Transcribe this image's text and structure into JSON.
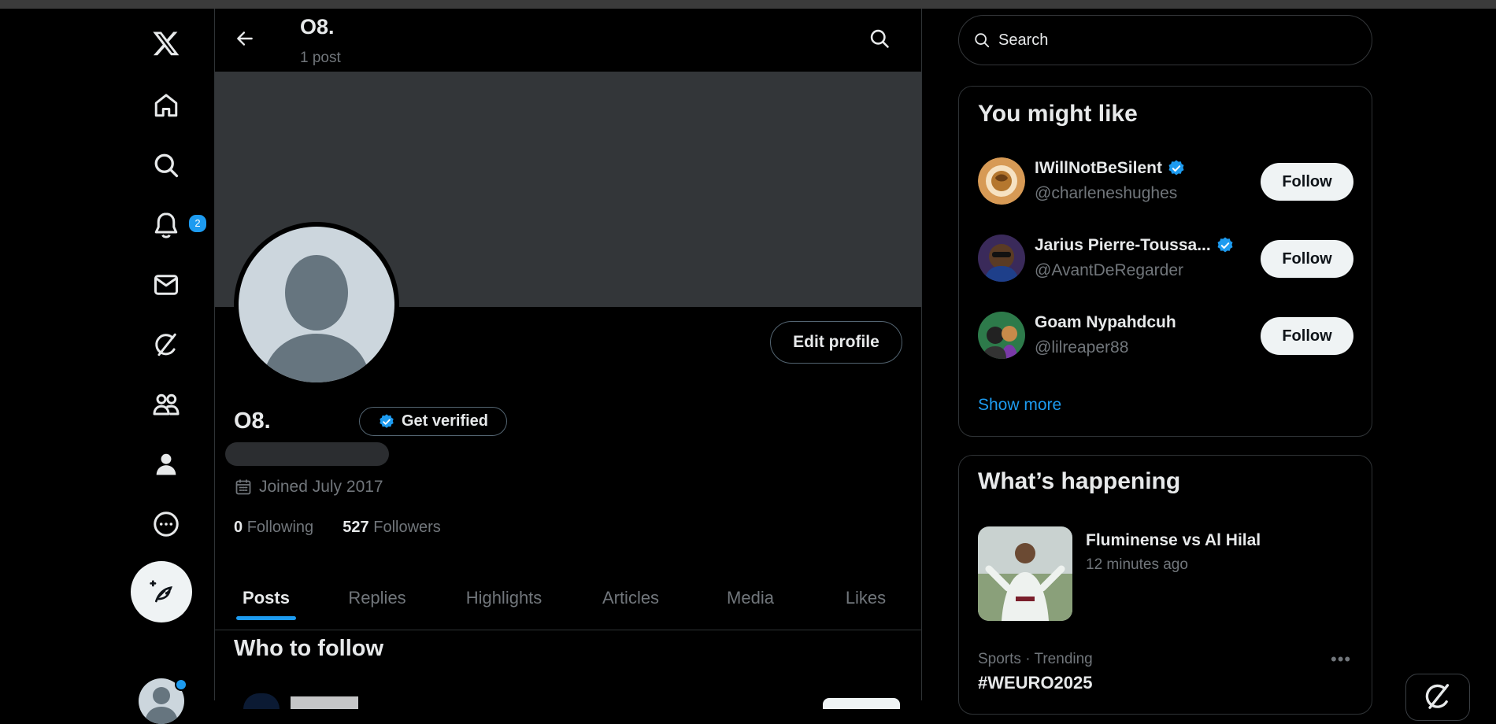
{
  "nav": {
    "notifications_badge": "2",
    "items": [
      "x-logo-icon",
      "home-icon",
      "explore-icon",
      "notifications-icon",
      "messages-icon",
      "grok-icon",
      "communities-icon",
      "profile-icon",
      "more-icon"
    ]
  },
  "profile": {
    "header_name": "O8.",
    "header_post_count": "1 post",
    "name": "O8.",
    "edit_label": "Edit profile",
    "get_verified_label": "Get verified",
    "joined": "Joined July 2017",
    "following_count": "0",
    "following_label": "Following",
    "followers_count": "527",
    "followers_label": "Followers"
  },
  "tabs": [
    {
      "label": "Posts",
      "active": true
    },
    {
      "label": "Replies"
    },
    {
      "label": "Highlights"
    },
    {
      "label": "Articles"
    },
    {
      "label": "Media"
    },
    {
      "label": "Likes"
    }
  ],
  "who_to_follow_title": "Who to follow",
  "search": {
    "placeholder": "Search"
  },
  "might_like": {
    "title": "You might like",
    "follow_label": "Follow",
    "show_more": "Show more",
    "users": [
      {
        "name": "IWillNotBeSilent",
        "handle": "@charleneshughes",
        "verified": true
      },
      {
        "name": "Jarius Pierre-Toussa...",
        "handle": "@AvantDeRegarder",
        "verified": true
      },
      {
        "name": "Goam Nypahdcuh",
        "handle": "@lilreaper88",
        "verified": false
      }
    ]
  },
  "happening": {
    "title": "What’s happening",
    "event_title": "Fluminense vs Al Hilal",
    "event_time": "12 minutes ago",
    "trend_category": "Sports · Trending",
    "trend_tag": "#WEURO2025"
  },
  "colors": {
    "accent": "#1d9bf0",
    "background": "#000000",
    "muted": "#71767b",
    "text": "#e7e9ea"
  }
}
